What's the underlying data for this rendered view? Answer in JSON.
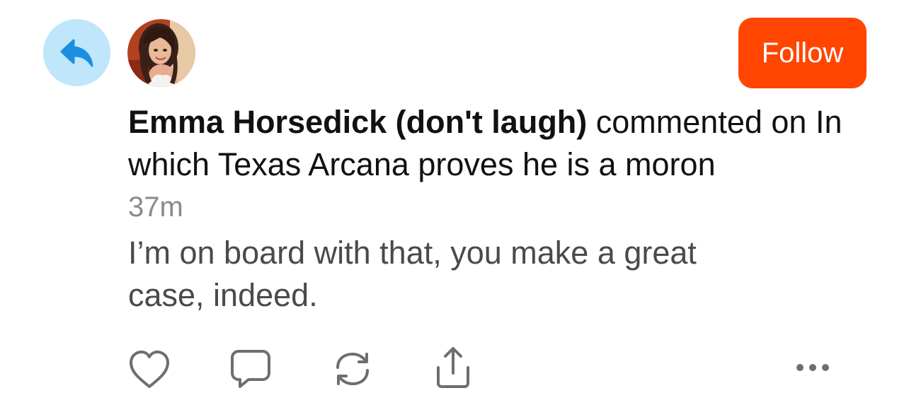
{
  "post": {
    "author": "Emma Horsedick (don't laugh)",
    "action_text": " commented on In which Texas Arcana proves he is a moron",
    "time": "37m",
    "comment": "I’m on board with that, you make a great case, indeed."
  },
  "follow_button": {
    "label": "Follow"
  },
  "icons": {
    "badge": "reply-arrow-icon",
    "avatar": "user-avatar",
    "like": "heart-icon",
    "comment": "speech-bubble-icon",
    "repost": "refresh-arrows-icon",
    "share": "share-upload-icon",
    "more": "ellipsis-icon"
  },
  "colors": {
    "accent": "#ff4500",
    "badge_bg": "#bfe6fb",
    "badge_icon": "#1d8fe0",
    "icon_gray": "#6e6e6e",
    "timestamp": "#8a8a8a",
    "body_text": "#4a4a4a"
  }
}
